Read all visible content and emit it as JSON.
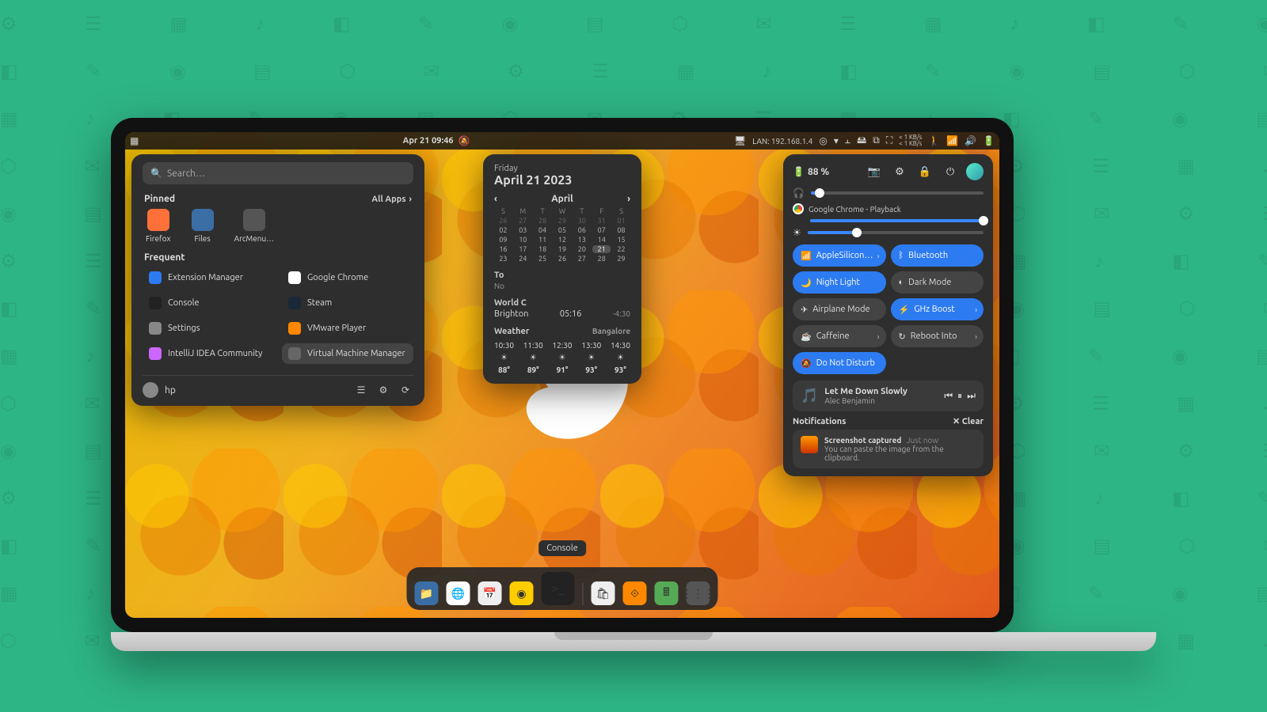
{
  "topbar": {
    "datetime": "Apr 21  09:46",
    "lan_label": "LAN: 192.168.1.4",
    "netspeed_up": "< 1 KB/s",
    "netspeed_down": "< 1 KB/s"
  },
  "appmenu": {
    "search_placeholder": "Search…",
    "pinned_label": "Pinned",
    "all_apps_label": "All Apps",
    "pinned": [
      {
        "name": "Firefox",
        "color": "#ff7139"
      },
      {
        "name": "Files",
        "color": "#3a6ea5"
      },
      {
        "name": "ArcMenu…",
        "color": "#555"
      }
    ],
    "frequent_label": "Frequent",
    "frequent": [
      {
        "name": "Extension Manager",
        "color": "#2d7bf0"
      },
      {
        "name": "Google Chrome",
        "color": "#fff"
      },
      {
        "name": "Console",
        "color": "#222"
      },
      {
        "name": "Steam",
        "color": "#1b2838"
      },
      {
        "name": "Settings",
        "color": "#888"
      },
      {
        "name": "VMware Player",
        "color": "#f80"
      },
      {
        "name": "IntelliJ IDEA Community",
        "color": "#c6f"
      },
      {
        "name": "Virtual Machine Manager",
        "color": "#666"
      }
    ],
    "user": "hp"
  },
  "calendar": {
    "weekday": "Friday",
    "full_date": "April 21 2023",
    "month_label": "April",
    "weekdays": [
      "S",
      "M",
      "T",
      "W",
      "T",
      "F",
      "S"
    ],
    "prev_trailing": [
      "26",
      "27",
      "28",
      "29",
      "30",
      "31",
      "01"
    ],
    "rows": [
      [
        "02",
        "03",
        "04",
        "05",
        "06",
        "07",
        "08"
      ],
      [
        "09",
        "10",
        "11",
        "12",
        "13",
        "14",
        "15"
      ],
      [
        "16",
        "17",
        "18",
        "19",
        "20",
        "21",
        "22"
      ],
      [
        "23",
        "24",
        "25",
        "26",
        "27",
        "28",
        "29"
      ]
    ],
    "today_cell": "21",
    "today_label": "To",
    "no_events": "No",
    "world_clocks_label": "World C",
    "world_clock_city": "Brighton",
    "world_clock_time": "05:16",
    "world_clock_offset": "-4:30",
    "weather_label": "Weather",
    "weather_city": "Bangalore",
    "forecast": [
      {
        "time": "10:30",
        "temp": "88°"
      },
      {
        "time": "11:30",
        "temp": "89°"
      },
      {
        "time": "12:30",
        "temp": "91°"
      },
      {
        "time": "13:30",
        "temp": "93°"
      },
      {
        "time": "14:30",
        "temp": "93°"
      }
    ]
  },
  "quicksettings": {
    "battery": "88 %",
    "playback_label": "Google Chrome - Playback",
    "sliders": {
      "headphones": 5,
      "playback": 100,
      "brightness": 28
    },
    "toggles": [
      {
        "label": "AppleSilicon…",
        "on": true,
        "chev": true
      },
      {
        "label": "Bluetooth",
        "on": true,
        "chev": false
      },
      {
        "label": "Night Light",
        "on": true,
        "chev": false
      },
      {
        "label": "Dark Mode",
        "on": false,
        "chev": false
      },
      {
        "label": "Airplane Mode",
        "on": false,
        "chev": false
      },
      {
        "label": "GHz Boost",
        "on": true,
        "chev": true
      },
      {
        "label": "Caffeine",
        "on": false,
        "chev": true
      },
      {
        "label": "Reboot Into",
        "on": false,
        "chev": true
      },
      {
        "label": "Do Not Disturb",
        "on": true,
        "chev": false
      }
    ],
    "media": {
      "title": "Let Me Down Slowly",
      "artist": "Alec Benjamin"
    },
    "notifications_label": "Notifications",
    "clear_label": "Clear",
    "notification": {
      "title": "Screenshot captured",
      "time": "Just now",
      "body": "You can paste the image from the clipboard."
    }
  },
  "dock": {
    "tooltip": "Console",
    "items": [
      {
        "name": "files",
        "color": "#3a6ea5"
      },
      {
        "name": "chrome",
        "color": "#fff"
      },
      {
        "name": "calendar",
        "color": "#eee"
      },
      {
        "name": "rhythmbox",
        "color": "#fc0"
      },
      {
        "name": "console",
        "color": "#222",
        "big": true
      },
      {
        "name": "software",
        "color": "#eee"
      },
      {
        "name": "vmware",
        "color": "#f80"
      },
      {
        "name": "calculator",
        "color": "#5a5"
      },
      {
        "name": "apps-grid",
        "color": "#555"
      }
    ]
  }
}
